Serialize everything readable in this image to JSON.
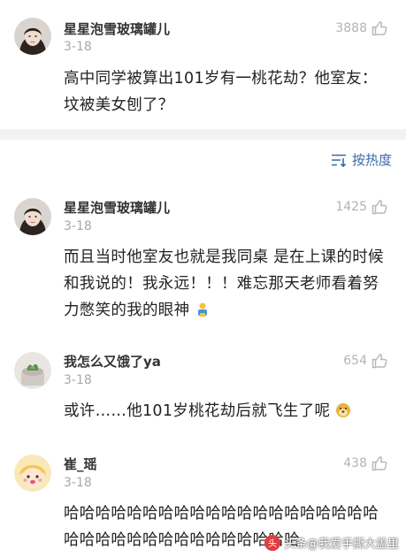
{
  "post": {
    "username": "星星泡雪玻璃罐儿",
    "date": "3-18",
    "likes": "3888",
    "content": "高中同学被算出101岁有一桃花劫？他室友：坟被美女刨了？"
  },
  "sort": {
    "label": "按热度"
  },
  "comments": [
    {
      "username": "星星泡雪玻璃罐儿",
      "date": "3-18",
      "likes": "1425",
      "content": "而且当时他室友也就是我同桌 是在上课的时候和我说的！我永远！！！难忘那天老师看着努力憋笑的我的眼神",
      "emoji": "lying-emoji"
    },
    {
      "username": "我怎么又饿了ya",
      "date": "3-18",
      "likes": "654",
      "content": "或许……他101岁桃花劫后就飞生了呢",
      "emoji": "doge-emoji"
    },
    {
      "username": "崔_瑶",
      "date": "3-18",
      "likes": "438",
      "content": "哈哈哈哈哈哈哈哈哈哈哈哈哈哈哈哈哈哈哈哈哈哈哈哈哈哈哈哈哈哈哈哈哈哈哈"
    }
  ],
  "watermark": {
    "text": "头条@我爱手撕大盖里"
  },
  "colors": {
    "accent": "#3b6aa8",
    "meta": "#a8a8a8",
    "divider": "#f2f2f2"
  }
}
